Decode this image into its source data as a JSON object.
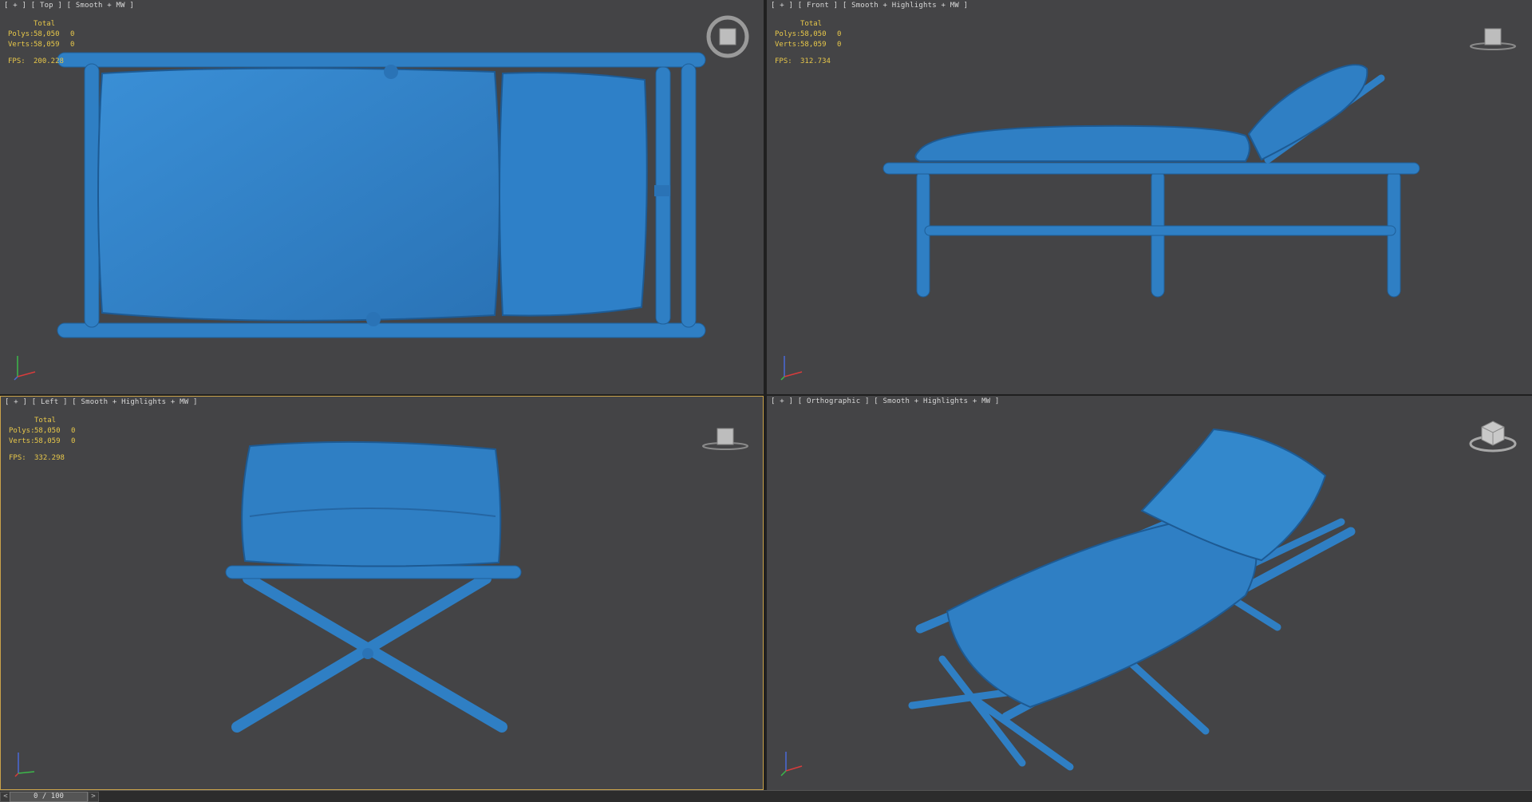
{
  "viewports": {
    "top": {
      "label": "[ + ] [ Top ] [ Smooth + MW ]",
      "stats_header": "Total",
      "polys_label": "Polys:",
      "polys_value": "58,050",
      "polys_sel": "0",
      "verts_label": "Verts:",
      "verts_value": "58,059",
      "verts_sel": "0",
      "fps_label": "FPS:",
      "fps_value": "200.228"
    },
    "front": {
      "label": "[ + ] [ Front ] [ Smooth + Highlights + MW ]",
      "stats_header": "Total",
      "polys_label": "Polys:",
      "polys_value": "58,050",
      "polys_sel": "0",
      "verts_label": "Verts:",
      "verts_value": "58,059",
      "verts_sel": "0",
      "fps_label": "FPS:",
      "fps_value": "312.734"
    },
    "left": {
      "label": "[ + ] [ Left ] [ Smooth + Highlights + MW ]",
      "stats_header": "Total",
      "polys_label": "Polys:",
      "polys_value": "58,050",
      "polys_sel": "0",
      "verts_label": "Verts:",
      "verts_value": "58,059",
      "verts_sel": "0",
      "fps_label": "FPS:",
      "fps_value": "332.298"
    },
    "ortho": {
      "label": "[ + ] [ Orthographic ] [ Smooth + Highlights + MW ]"
    }
  },
  "timeline": {
    "prev_label": "<",
    "frame_label": "0 / 100",
    "next_label": ">"
  },
  "colors": {
    "viewport_bg": "#444446",
    "model_blue": "#2f7fc4",
    "stats_yellow": "#e8c84a",
    "active_border": "#c9a24a"
  },
  "icons": {
    "viewcube": "viewcube-icon",
    "axis": "axis-tripod-icon"
  }
}
